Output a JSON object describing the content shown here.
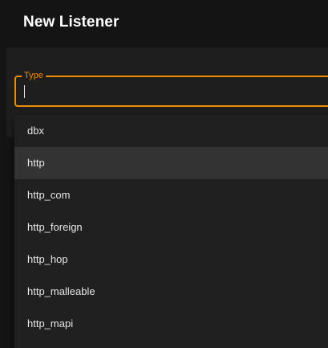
{
  "dialog": {
    "title": "New Listener"
  },
  "type_field": {
    "label": "Type",
    "value": ""
  },
  "dropdown": {
    "selected": "http",
    "options": [
      "dbx",
      "http",
      "http_com",
      "http_foreign",
      "http_hop",
      "http_malleable",
      "http_mapi"
    ]
  },
  "colors": {
    "accent": "#f08c00",
    "background": "#141414",
    "surface": "#1e1e1e",
    "highlight": "#333333"
  }
}
